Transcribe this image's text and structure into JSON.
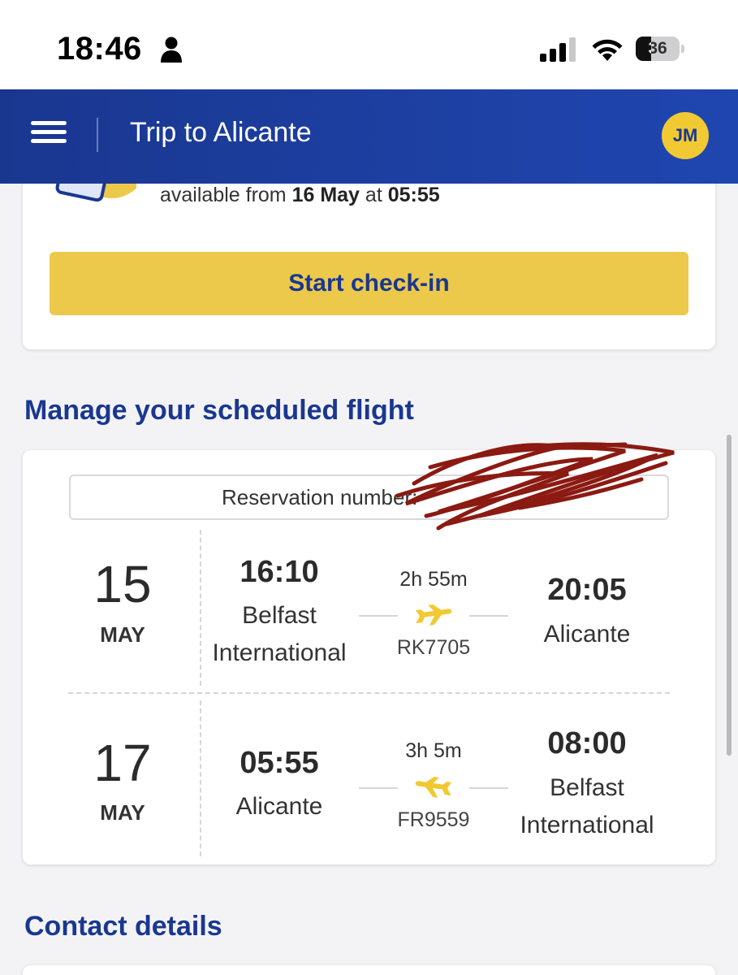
{
  "status_bar": {
    "time": "18:46",
    "battery_level": 36,
    "battery_label": "36"
  },
  "header": {
    "title": "Trip to Alicante",
    "avatar_initials": "JM"
  },
  "checkin": {
    "available_prefix": "available from ",
    "available_date": "16 May",
    "available_mid": " at ",
    "available_time": "05:55",
    "button_label": "Start check-in"
  },
  "manage": {
    "title": "Manage your scheduled flight",
    "reservation_label": "Reservation number:",
    "flights": [
      {
        "day": "15",
        "month": "MAY",
        "depart_time": "16:10",
        "depart_city_line1": "Belfast",
        "depart_city_line2": "International",
        "duration": "2h 55m",
        "flight_number": "RK7705",
        "arrive_time": "20:05",
        "arrive_city_line1": "Alicante",
        "arrive_city_line2": ""
      },
      {
        "day": "17",
        "month": "MAY",
        "depart_time": "05:55",
        "depart_city_line1": "Alicante",
        "depart_city_line2": "",
        "duration": "3h 5m",
        "flight_number": "FR9559",
        "arrive_time": "08:00",
        "arrive_city_line1": "Belfast",
        "arrive_city_line2": "International"
      }
    ]
  },
  "contact": {
    "title": "Contact details"
  },
  "colors": {
    "brand_blue": "#1a3790",
    "accent_yellow": "#ecc94b",
    "plane_yellow": "#f1c933"
  },
  "icons": [
    "person-icon",
    "signal-icon",
    "wifi-icon",
    "battery-icon",
    "menu-icon",
    "plane-icon"
  ]
}
